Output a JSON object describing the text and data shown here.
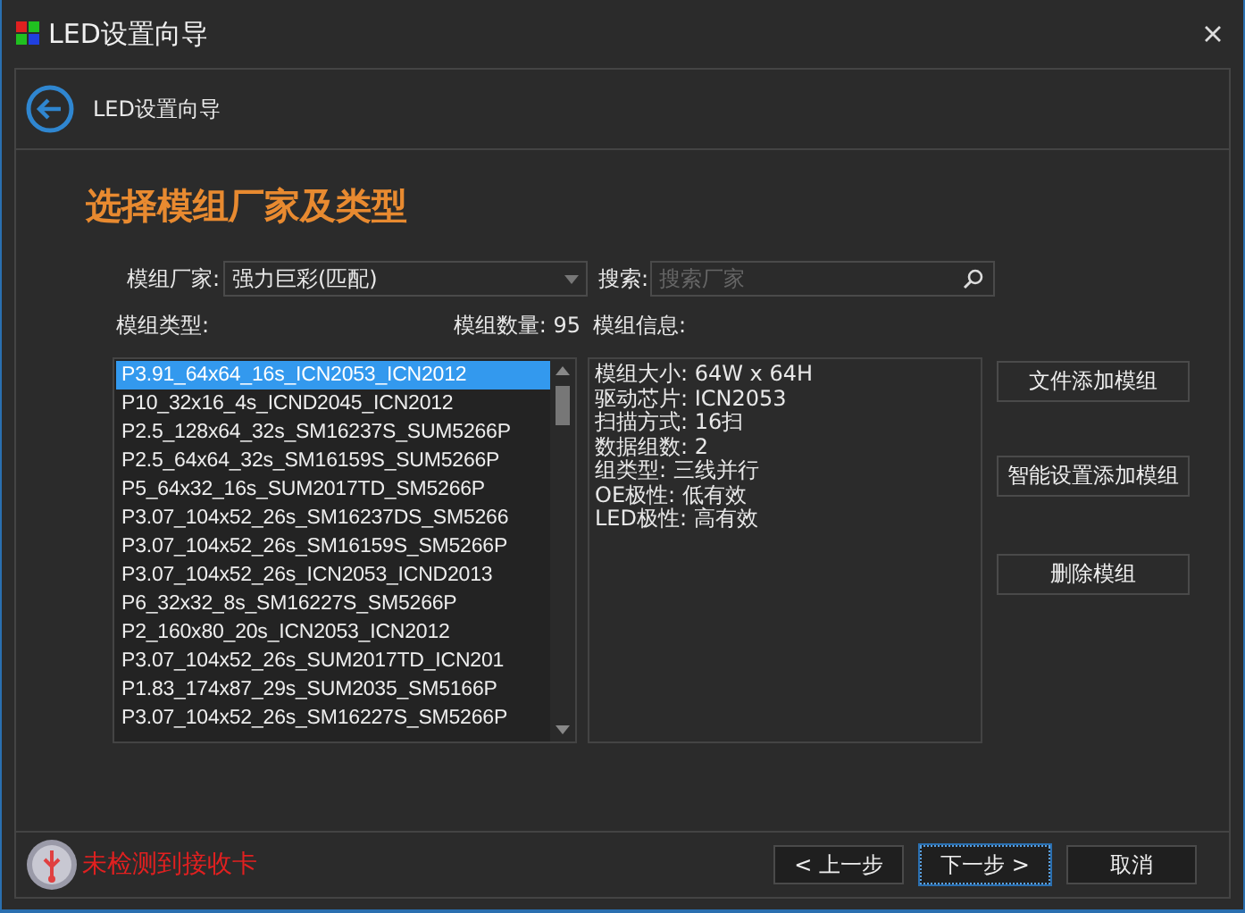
{
  "window": {
    "title": "LED设置向导"
  },
  "header": {
    "title": "LED设置向导"
  },
  "heading": "选择模组厂家及类型",
  "vendor": {
    "label": "模组厂家:",
    "value": "强力巨彩(匹配)"
  },
  "search": {
    "label": "搜索:",
    "placeholder": "搜索厂家"
  },
  "module_type_label": "模组类型:",
  "module_count": {
    "label": "模组数量:",
    "value": "95"
  },
  "module_info_label": "模组信息:",
  "modules": [
    {
      "name": "P3.91_64x64_16s_ICN2053_ICN2012",
      "selected": true
    },
    {
      "name": "P10_32x16_4s_ICND2045_ICN2012",
      "selected": false
    },
    {
      "name": "P2.5_128x64_32s_SM16237S_SUM5266P",
      "selected": false
    },
    {
      "name": "P2.5_64x64_32s_SM16159S_SUM5266P",
      "selected": false
    },
    {
      "name": "P5_64x32_16s_SUM2017TD_SM5266P",
      "selected": false
    },
    {
      "name": "P3.07_104x52_26s_SM16237DS_SM5266",
      "selected": false
    },
    {
      "name": "P3.07_104x52_26s_SM16159S_SM5266P",
      "selected": false
    },
    {
      "name": "P3.07_104x52_26s_ICN2053_ICND2013",
      "selected": false
    },
    {
      "name": "P6_32x32_8s_SM16227S_SM5266P",
      "selected": false
    },
    {
      "name": "P2_160x80_20s_ICN2053_ICN2012",
      "selected": false
    },
    {
      "name": "P3.07_104x52_26s_SUM2017TD_ICN201",
      "selected": false
    },
    {
      "name": "P1.83_174x87_29s_SUM2035_SM5166P",
      "selected": false
    },
    {
      "name": "P3.07_104x52_26s_SM16227S_SM5266P",
      "selected": false
    }
  ],
  "module_info": [
    "模组大小: 64W x 64H",
    "驱动芯片: ICN2053",
    "扫描方式: 16扫",
    "数据组数: 2",
    "组类型: 三线并行",
    "OE极性: 低有效",
    "LED极性: 高有效"
  ],
  "side_buttons": [
    "文件添加模组",
    "智能设置添加模组",
    "删除模组"
  ],
  "status": {
    "text": "未检测到接收卡",
    "connected": false
  },
  "footer_buttons": [
    {
      "label": "< 上一步",
      "focused": false
    },
    {
      "label": "下一步 >",
      "focused": true
    },
    {
      "label": "取消",
      "focused": false
    }
  ]
}
